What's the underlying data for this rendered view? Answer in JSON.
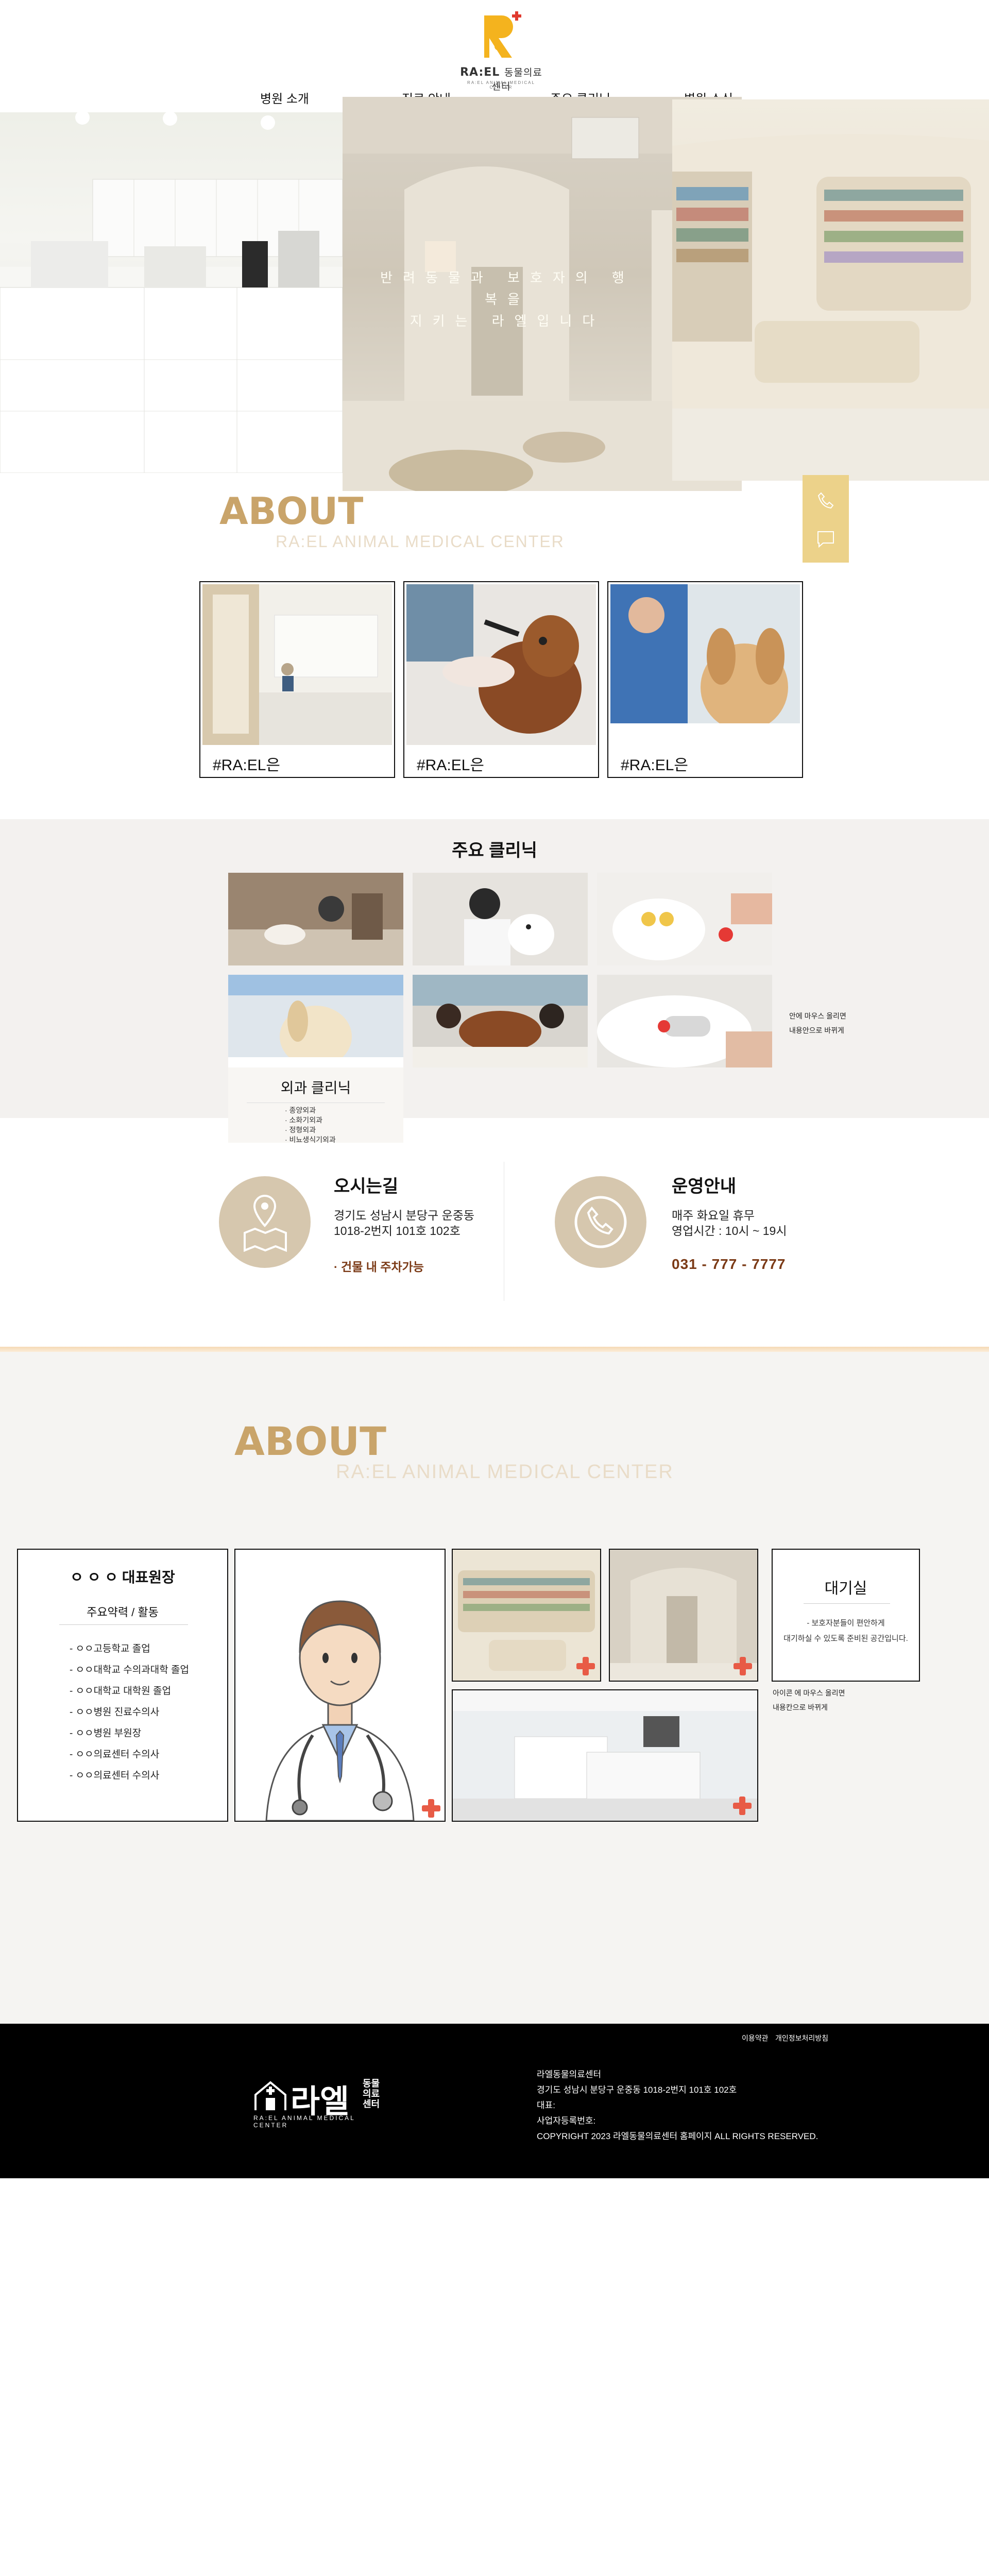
{
  "colors": {
    "accent_gold": "#c9a46a",
    "quick_bar": "#ecd28a",
    "info_circle": "#d6c7ae",
    "accent_brown": "#7b3a16",
    "plus_red": "#e85b46",
    "footer_bg": "#000000"
  },
  "header": {
    "logo_word": "RA:EL",
    "logo_kr": "동물의료센터",
    "logo_en": "RA:EL ANIMAL MEDICAL CENTER",
    "nav": [
      "병원 소개",
      "진료 안내",
      "주요 클리닉",
      "병원 소식"
    ]
  },
  "hero": {
    "text_line1": "반려동물과 보호자의 행복을",
    "text_line2": "지키는 라엘입니다"
  },
  "quick_bar": {
    "icons": [
      "phone-icon",
      "chat-icon"
    ]
  },
  "about1": {
    "title": "ABOUT",
    "subtitle": "RA:EL ANIMAL MEDICAL CENTER",
    "cards": [
      {
        "caption": "#RA:EL은"
      },
      {
        "caption": "#RA:EL은"
      },
      {
        "caption": "#RA:EL은"
      }
    ]
  },
  "clinic": {
    "title": "주요 클리닉",
    "surgery_title": "외과 클리닉",
    "surgery_items": [
      "· 종양외과",
      "· 소화기외과",
      "· 정형외과",
      "· 비뇨생식기외과"
    ],
    "note_line1": "안에 마우스 올리면",
    "note_line2": "내용안으로 바뀌게"
  },
  "info": {
    "directions": {
      "title": "오시는길",
      "line1": "경기도 성남시 분당구 운중동",
      "line2": "1018-2번지 101호 102호",
      "parking": "· 건물 내 주차가능"
    },
    "hours": {
      "title": "운영안내",
      "line1": "매주 화요일 휴무",
      "line2": "영업시간 : 10시 ~ 19시",
      "phone": "031 - 777 - 7777"
    }
  },
  "about2": {
    "title": "ABOUT",
    "subtitle": "RA:EL ANIMAL MEDICAL CENTER",
    "director": {
      "title": "ㅇ ㅇ ㅇ  대표원장",
      "sub": "주요약력 / 활동",
      "items": [
        "- ㅇㅇ고등학교 졸업",
        "- ㅇㅇ대학교 수의과대학 졸업",
        "- ㅇㅇ대학교 대학원 졸업",
        "- ㅇㅇ병원 진료수의사",
        "- ㅇㅇ병원 부원장",
        "- ㅇㅇ의료센터 수의사",
        "- ㅇㅇ의료센터 수의사"
      ]
    },
    "waiting": {
      "title": "대기실",
      "line1": "- 보호자분들이 편안하게",
      "line2": "대기하실 수 있도록 준비된 공간입니다."
    },
    "note_line1": "아이콘 에 마우스 올리면",
    "note_line2": "내용칸으로 바뀌게"
  },
  "footer": {
    "links": [
      "이용약관",
      "개인정보처리방침"
    ],
    "logo_kr": "라엘",
    "logo_kr_small": [
      "동물",
      "의료",
      "센터"
    ],
    "logo_en": "RA:EL ANIMAL MEDICAL CENTER",
    "name": "라엘동물의료센터",
    "address": "경기도 성남시 분당구 운중동 1018-2번지 101호 102호",
    "rep": "대표:",
    "biz": "사업자등록번호:",
    "copyright": "COPYRIGHT 2023 라엘동물의료센터 홈페이지 ALL RIGHTS RESERVED."
  }
}
